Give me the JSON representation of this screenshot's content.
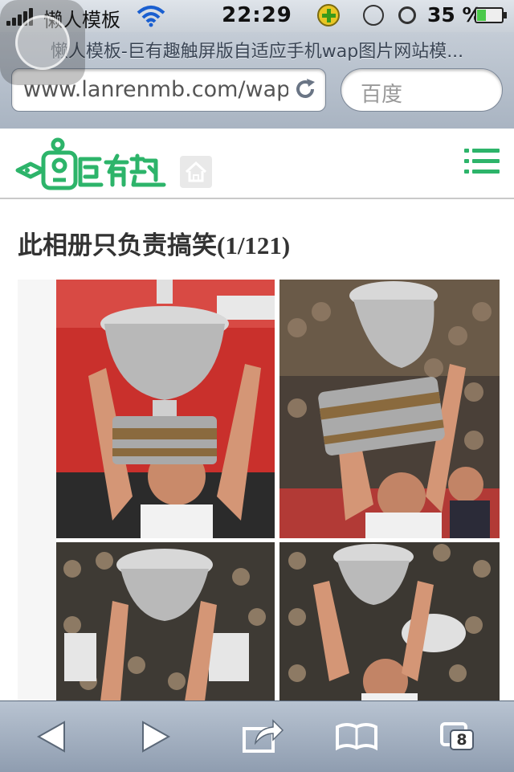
{
  "status_bar": {
    "carrier": "懒人模板",
    "time": "22:29",
    "battery": "35 %",
    "battery_level": 0.35
  },
  "browser": {
    "page_title": "懒人模板-巨有趣触屏版自适应手机wap图片网站模...",
    "url": "www.lanrenmb.com/wap",
    "search_placeholder": "百度",
    "tab_count": "8"
  },
  "site": {
    "logo_text": "巨有趣",
    "menu_icon": "hamburger-icon",
    "home_icon": "home-icon"
  },
  "album": {
    "title": "此相册只负责搞笑",
    "counter": "(1/121)"
  },
  "colors": {
    "brand_green": "#2db46a",
    "trophy_red": "#d43a36",
    "chrome_blue": "#a9b4c2"
  }
}
